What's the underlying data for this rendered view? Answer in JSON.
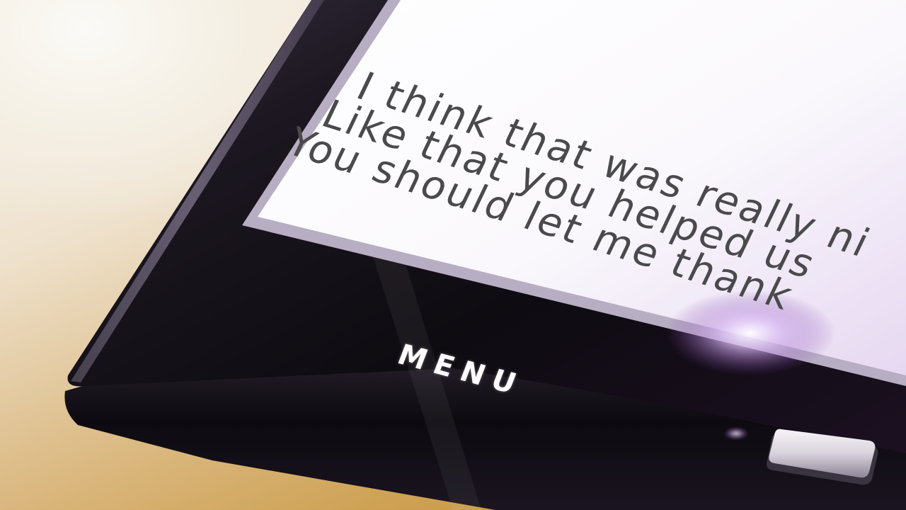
{
  "dialogue": {
    "lines": [
      "I think that was really ni",
      "Like that you helped us",
      "You should let me thank"
    ]
  },
  "menu": {
    "label": "MENU"
  },
  "colors": {
    "text": "#4a4a4c",
    "bezel": "#141116",
    "screen_glow": "#c7a6e6",
    "background_warm": "#c8963f"
  },
  "icons": {
    "side_button": "physical-button"
  }
}
